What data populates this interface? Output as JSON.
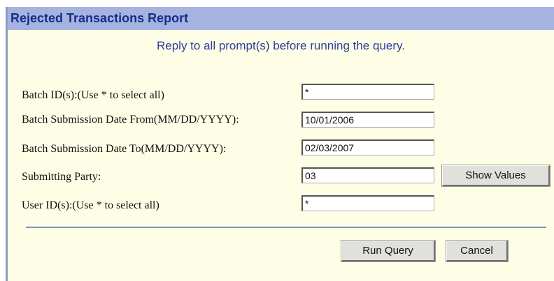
{
  "window": {
    "title": "Rejected Transactions Report"
  },
  "instruction": "Reply to all prompt(s) before running the query.",
  "fields": [
    {
      "label": "Batch ID(s):(Use * to select all)",
      "value": "*"
    },
    {
      "label": "Batch Submission Date From(MM/DD/YYYY):",
      "value": "10/01/2006"
    },
    {
      "label": "Batch Submission Date To(MM/DD/YYYY):",
      "value": "02/03/2007"
    },
    {
      "label": "Submitting Party:",
      "value": "03"
    },
    {
      "label": "User ID(s):(Use * to select all)",
      "value": "*"
    }
  ],
  "buttons": {
    "show_values": "Show Values",
    "run_query": "Run Query",
    "cancel": "Cancel"
  },
  "colors": {
    "titlebar_bg": "#a5b3e0",
    "title_text": "#1a2d8a",
    "panel_bg": "#fefee6",
    "instruction_text": "#2a3f9e"
  }
}
